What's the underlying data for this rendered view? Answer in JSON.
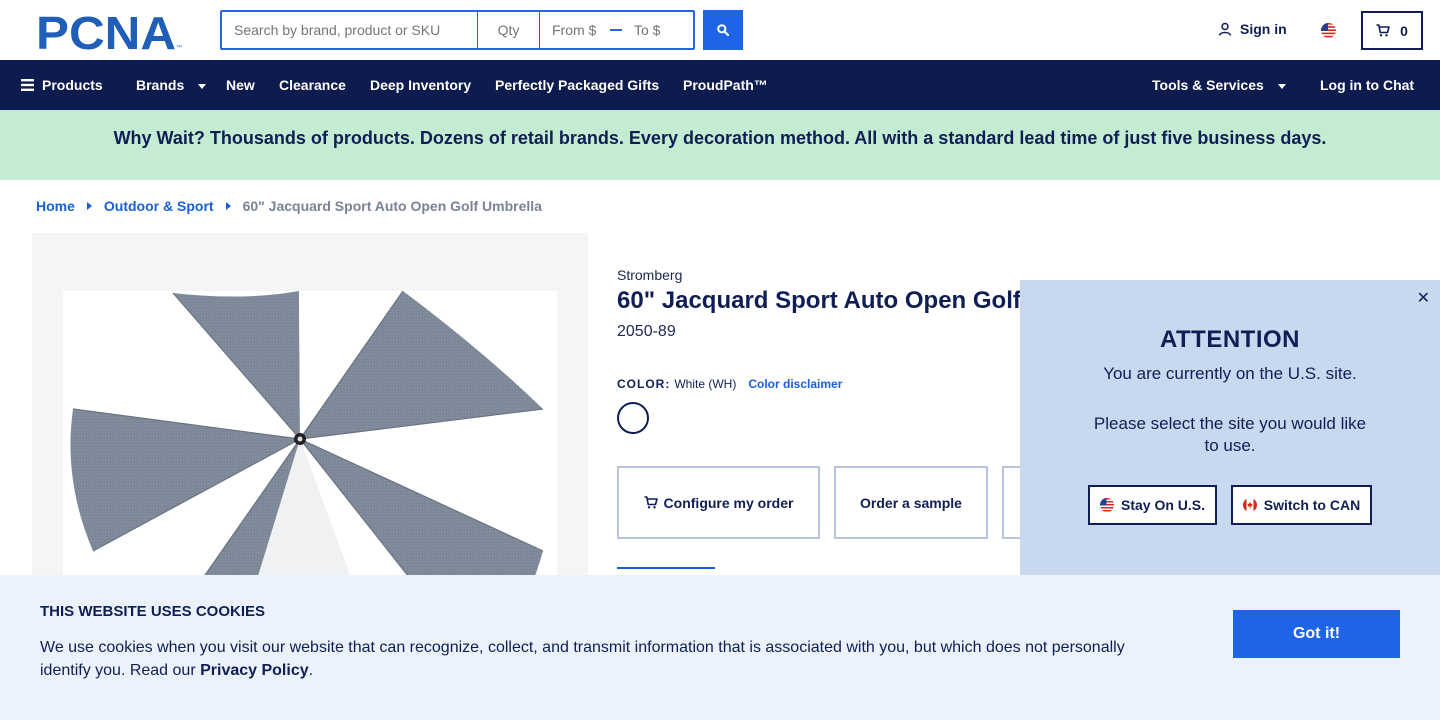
{
  "header": {
    "logo_text": "PCNA",
    "search_placeholder": "Search by brand, product or SKU",
    "qty_placeholder": "Qty",
    "from_placeholder": "From $",
    "to_placeholder": "To $",
    "sign_in": "Sign in",
    "cart_count": "0"
  },
  "nav": {
    "products": "Products",
    "brands": "Brands",
    "new": "New",
    "clearance": "Clearance",
    "deep_inventory": "Deep Inventory",
    "gifts": "Perfectly Packaged Gifts",
    "proudpath": "ProudPath™",
    "tools": "Tools & Services",
    "chat": "Log in to Chat"
  },
  "promo": "Why Wait? Thousands of products. Dozens of retail brands. Every decoration method. All with a standard lead time of just five business days.",
  "breadcrumb": {
    "home": "Home",
    "category": "Outdoor & Sport",
    "current": "60\" Jacquard Sport Auto Open Golf Umbrella"
  },
  "product": {
    "brand": "Stromberg",
    "title": "60\" Jacquard Sport Auto Open Golf",
    "sku": "2050-89",
    "color_label": "COLOR:",
    "color_value": "White (WH)",
    "color_disclaimer": "Color disclaimer",
    "configure": "Configure my order",
    "sample": "Order a sample"
  },
  "attention": {
    "title": "ATTENTION",
    "line1": "You are currently on the U.S. site.",
    "line2": "Please select the site you would like to use.",
    "stay": "Stay On U.S.",
    "switch": "Switch to CAN",
    "close": "✕"
  },
  "cookie": {
    "title": "THIS WEBSITE USES COOKIES",
    "text": "We use cookies when you visit our website that can recognize, collect, and transmit information that is associated with you, but which does not personally identify you. Read our ",
    "link": "Privacy Policy",
    "end": ".",
    "button": "Got it!"
  },
  "colors": {
    "navy": "#0d1b4f",
    "accent_blue": "#1f64e6",
    "promo_green": "#c3ecd3",
    "popup_bg": "#c8d8ef",
    "cookie_bg": "#ebf2fb"
  }
}
